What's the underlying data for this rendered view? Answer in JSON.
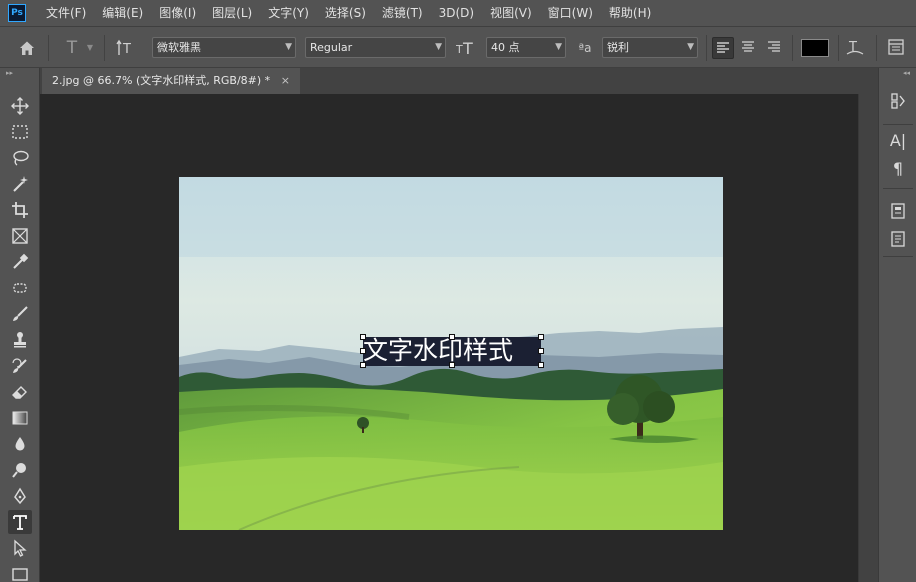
{
  "menu": {
    "logo": "Ps",
    "items": [
      "文件(F)",
      "编辑(E)",
      "图像(I)",
      "图层(L)",
      "文字(Y)",
      "选择(S)",
      "滤镜(T)",
      "3D(D)",
      "视图(V)",
      "窗口(W)",
      "帮助(H)"
    ]
  },
  "options": {
    "font_family": "微软雅黑",
    "font_style": "Regular",
    "font_size": "40 点",
    "aa_label": "ªa",
    "antialias": "锐利",
    "text_color": "#000000"
  },
  "document": {
    "tab_title": "2.jpg @ 66.7% (文字水印样式, RGB/8#) *",
    "close_glyph": "×"
  },
  "text_layer": {
    "content": "文字水印样式"
  },
  "icons": {
    "home": "home-icon",
    "type_tool": "type-tool-icon",
    "orientation": "text-orientation-icon",
    "font_size": "font-size-icon",
    "align_left": "align-left-icon",
    "align_center": "align-center-icon",
    "align_right": "align-right-icon",
    "warp": "warp-text-icon",
    "panels": "character-panel-icon"
  }
}
